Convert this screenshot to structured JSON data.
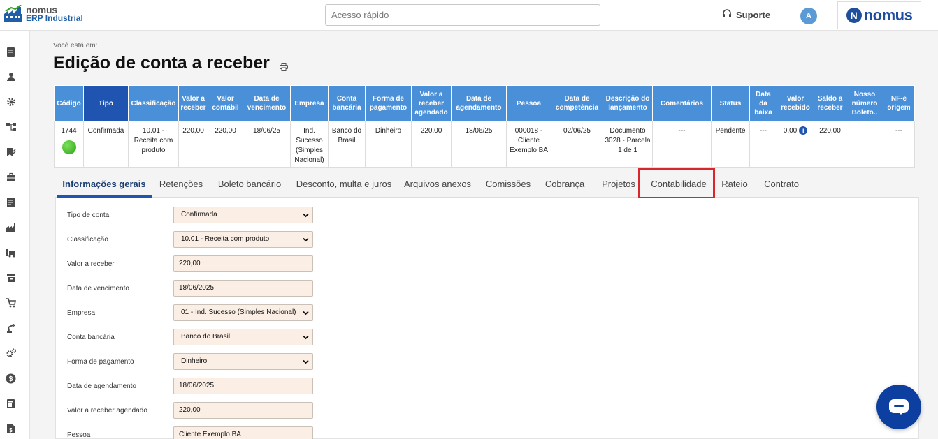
{
  "app": {
    "logo_line1": "nomus",
    "logo_line2": "ERP Industrial",
    "quick_access_placeholder": "Acesso rápido",
    "support_label": "Suporte",
    "avatar_letter": "A",
    "brand_wordmark": "nomus",
    "brand_letter": "N"
  },
  "sidebar": {
    "icons": [
      "document-icon",
      "user-icon",
      "gear-icon",
      "flow-icon",
      "book-icon",
      "briefcase-icon",
      "ledger-icon",
      "factory-icon",
      "truck-icon",
      "archive-icon",
      "cart-icon",
      "robot-arm-icon",
      "gears-icon",
      "dollar-icon",
      "calculator-icon",
      "invoice-icon"
    ]
  },
  "page": {
    "breadcrumb": "Você está em:",
    "title": "Edição de conta a receber"
  },
  "table": {
    "headers": [
      "Código",
      "Tipo",
      "Classificação",
      "Valor a receber",
      "Valor contábil",
      "Data de vencimento",
      "Empresa",
      "Conta bancária",
      "Forma de pagamento",
      "Valor a receber agendado",
      "Data de agendamento",
      "Pessoa",
      "Data de competência",
      "Descrição do lançamento",
      "Comentários",
      "Status",
      "Data da baixa",
      "Valor recebido",
      "Saldo a receber",
      "Nosso número Boleto..",
      "NF-e origem"
    ],
    "row": {
      "codigo": "1744",
      "tipo": "Confirmada",
      "classificacao": "10.01 - Receita com produto",
      "valor_receber": "220,00",
      "valor_contabil": "220,00",
      "data_vencimento": "18/06/25",
      "empresa": "Ind. Sucesso (Simples Nacional)",
      "conta_bancaria": "Banco do Brasil",
      "forma_pagamento": "Dinheiro",
      "valor_agendado": "220,00",
      "data_agendamento": "18/06/25",
      "pessoa": "000018 - Cliente Exemplo BA",
      "data_competencia": "02/06/25",
      "descricao": "Documento 3028 - Parcela 1 de 1",
      "comentarios": "---",
      "status": "Pendente",
      "data_baixa": "---",
      "valor_recebido": "0,00",
      "saldo_receber": "220,00",
      "nosso_numero": "",
      "nfe_origem": "---"
    },
    "status_dot_color": "#2ea21a"
  },
  "tabs": [
    "Informações gerais",
    "Retenções",
    "Boleto bancário",
    "Desconto, multa e juros",
    "Arquivos anexos",
    "Comissões",
    "Cobrança",
    "Projetos",
    "Contabilidade",
    "Rateio",
    "Contrato"
  ],
  "active_tab": "Informações gerais",
  "highlighted_tab": "Contabilidade",
  "form": {
    "fields": [
      {
        "label": "Tipo de conta",
        "value": "Confirmada",
        "type": "select"
      },
      {
        "label": "Classificação",
        "value": "10.01 - Receita com produto",
        "type": "select"
      },
      {
        "label": "Valor a receber",
        "value": "220,00",
        "type": "text"
      },
      {
        "label": "Data de vencimento",
        "value": "18/06/2025",
        "type": "text"
      },
      {
        "label": "Empresa",
        "value": "01 - Ind. Sucesso (Simples Nacional)",
        "type": "select"
      },
      {
        "label": "Conta bancária",
        "value": "Banco do Brasil",
        "type": "select"
      },
      {
        "label": "Forma de pagamento",
        "value": "Dinheiro",
        "type": "select"
      },
      {
        "label": "Data de agendamento",
        "value": "18/06/2025",
        "type": "text"
      },
      {
        "label": "Valor a receber agendado",
        "value": "220,00",
        "type": "text"
      },
      {
        "label": "Pessoa",
        "value": "Cliente Exemplo BA",
        "type": "text"
      }
    ]
  },
  "colors": {
    "header_blue": "#4a90d9",
    "header_dark": "#1f55b0",
    "field_bg": "#faeee5",
    "highlight_red": "#d9262a",
    "chat_button": "#0d3fa0"
  }
}
